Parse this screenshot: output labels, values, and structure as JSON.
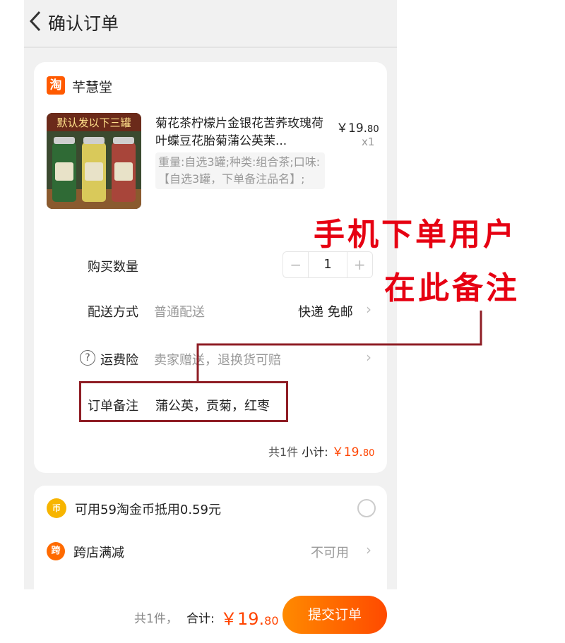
{
  "header": {
    "title": "确认订单"
  },
  "shop": {
    "logo_text": "淘",
    "name": "芊慧堂"
  },
  "product": {
    "image_caption": "默认发以下三罐",
    "title": "菊花茶柠檬片金银花苦荞玫瑰荷叶蝶豆花胎菊蒲公英茉...",
    "price_main": "￥19.",
    "price_cents": "80",
    "qty": "x1",
    "sku": "重量:自选3罐;种类:组合茶;口味:【自选3罐，下单备注品名】;"
  },
  "order": {
    "quantity_label": "购买数量",
    "quantity_value": "1",
    "minus": "−",
    "plus": "+",
    "delivery_label": "配送方式",
    "delivery_sub": "普通配送",
    "delivery_value": "快递 免邮",
    "insurance_label": "运费险",
    "insurance_sub": "卖家赠送，退换货可赔",
    "note_label": "订单备注",
    "note_value": "蒲公英，贡菊，红枣",
    "subtotal_count": "共1件 ",
    "subtotal_label": "小计: ",
    "subtotal_main": "￥19.",
    "subtotal_cents": "80"
  },
  "benefits": {
    "coin_icon": "币",
    "coin_text": "可用59淘金币抵用0.59元",
    "cross_icon": "跨",
    "cross_label": "跨店满减",
    "cross_value": "不可用"
  },
  "footer": {
    "count": "共1件，",
    "total_label": "合计:",
    "total_main": "￥19.",
    "total_cents": "80",
    "submit": "提交订单"
  },
  "annotation": {
    "line1": "手机下单用户",
    "line2": "在此备注"
  },
  "colors": {
    "accent": "#ff4400",
    "annotation_red": "#e60012",
    "box_red": "#8f1e25",
    "brand_orange": "#ff5a00"
  }
}
